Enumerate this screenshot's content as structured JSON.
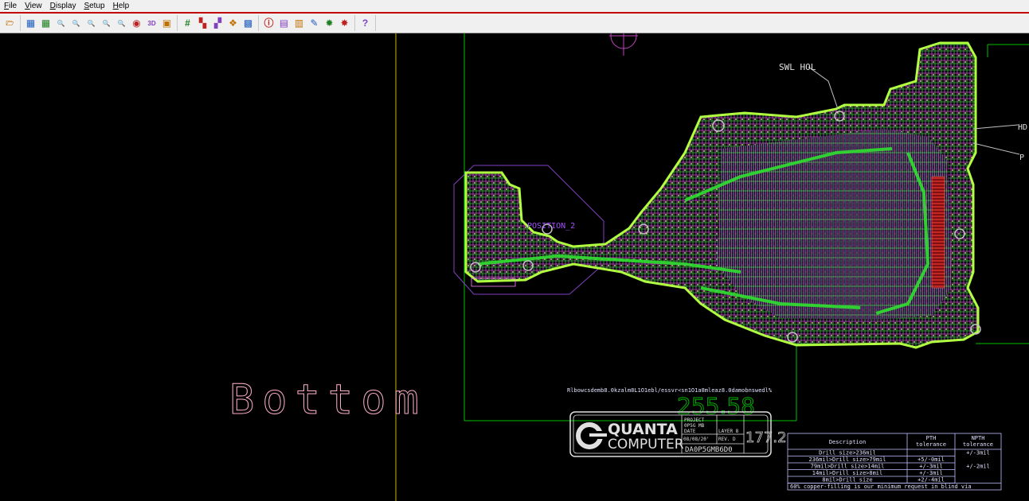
{
  "menu": {
    "items": [
      {
        "label": "File",
        "name": "menu-file"
      },
      {
        "label": "View",
        "name": "menu-view"
      },
      {
        "label": "Display",
        "name": "menu-display"
      },
      {
        "label": "Setup",
        "name": "menu-setup"
      },
      {
        "label": "Help",
        "name": "menu-help"
      }
    ]
  },
  "toolbar": {
    "groups": [
      [
        {
          "icon": "open-folder-icon",
          "glyph": "🗁"
        }
      ],
      [
        {
          "icon": "zoom-fit-icon",
          "glyph": "▦"
        },
        {
          "icon": "zoom-all-icon",
          "glyph": "▦"
        },
        {
          "icon": "zoom-window-icon",
          "glyph": "🔍"
        },
        {
          "icon": "zoom-in-icon",
          "glyph": "🔍"
        },
        {
          "icon": "zoom-out-icon",
          "glyph": "🔍"
        },
        {
          "icon": "zoom-previous-icon",
          "glyph": "🔍"
        },
        {
          "icon": "zoom-redraw-icon",
          "glyph": "🔍"
        },
        {
          "icon": "refresh-icon",
          "glyph": "◉"
        },
        {
          "icon": "view-3d-icon",
          "glyph": "3D"
        },
        {
          "icon": "film-icon",
          "glyph": "▣"
        }
      ],
      [
        {
          "icon": "grid-icon",
          "glyph": "#"
        },
        {
          "icon": "layers-icon",
          "glyph": "▚"
        },
        {
          "icon": "layer-stack-icon",
          "glyph": "▞"
        },
        {
          "icon": "color-icon",
          "glyph": "❖"
        },
        {
          "icon": "board-icon",
          "glyph": "▩"
        }
      ],
      [
        {
          "icon": "info-icon",
          "glyph": "ⓘ"
        },
        {
          "icon": "properties-icon",
          "glyph": "▤"
        },
        {
          "icon": "measure-icon",
          "glyph": "▥"
        },
        {
          "icon": "brush-icon",
          "glyph": "✎"
        },
        {
          "icon": "highlight-icon",
          "glyph": "✹"
        },
        {
          "icon": "dehighlight-icon",
          "glyph": "✸"
        }
      ],
      [
        {
          "icon": "help-icon",
          "glyph": "?"
        }
      ]
    ]
  },
  "canvas": {
    "background": "#000000",
    "layer_label": "Bottom",
    "annotations": {
      "swl_hole": "SWL HOL",
      "position": "POSITION_2",
      "right_label_1": "HD",
      "right_label_2": "P"
    },
    "dimension_width": "255.58",
    "dimension_height": "177.2",
    "fab_note": "Rlbowcsdemb8.0kzalm8L1O1ebl/essvr<sn1O1a8mleaz8.0damobnswedl%"
  },
  "title_block": {
    "company_line1": "QUANTA",
    "company_line2": "COMPUTER",
    "project_label": "PROJECT",
    "project_value": "0P5G MB",
    "date_label": "DATE",
    "date_value": "08/08/20'",
    "layer_label": "LAYER 8",
    "rev_label": "REV. D",
    "part_number": "DA0P5GMB6D0"
  },
  "drill_table": {
    "headers": [
      "Description",
      "PTH\ntolerance",
      "NPTH\ntolerance"
    ],
    "rows": [
      [
        "Drill size>236mil",
        "",
        "+/-3mil"
      ],
      [
        "236mil>Drill size>79mil",
        "+5/-0mil",
        ""
      ],
      [
        "79mil>Drill size>14mil",
        "+/-3mil",
        "+/-2mil"
      ],
      [
        "14mil>Drill size>8mil",
        "+/-3mil",
        ""
      ],
      [
        "8mil>Drill size",
        "+2/-4mil",
        ""
      ]
    ],
    "footer": "60% copper-filling is our minimum request in blind via"
  },
  "colors": {
    "accent_rule": "#c00000",
    "outline_green": "#00c000",
    "trace_magenta": "#ff40ff",
    "trace_green": "#40ff40",
    "yellow_line": "#c8b400",
    "purple_outline": "#8040c0",
    "layer_text": "#ffb0c8"
  }
}
